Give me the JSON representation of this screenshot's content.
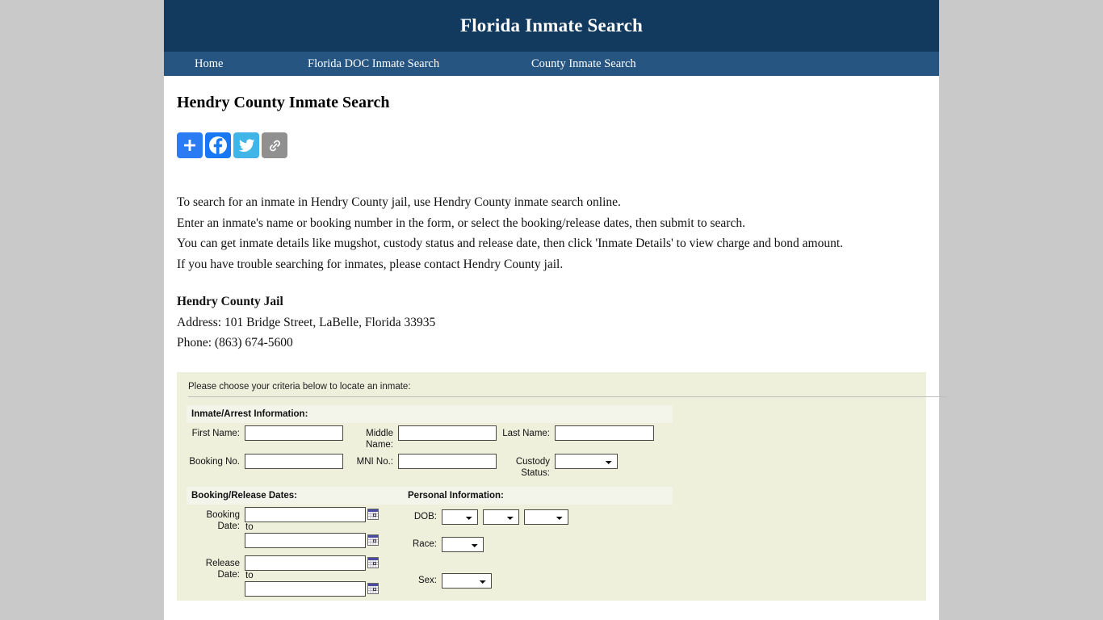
{
  "site": {
    "title": "Florida Inmate Search"
  },
  "nav": {
    "items": [
      {
        "label": "Home",
        "name": "nav-item-home"
      },
      {
        "label": "Florida DOC Inmate Search",
        "name": "nav-item-florida-doc-inmate-search"
      },
      {
        "label": "County Inmate Search",
        "name": "nav-item-county-inmate-search"
      }
    ]
  },
  "page": {
    "title": "Hendry County Inmate Search"
  },
  "share": {
    "buttons": [
      {
        "label": "Share",
        "icon": "plus-icon",
        "color": "#2b7bf3"
      },
      {
        "label": "Facebook",
        "icon": "facebook-icon",
        "color": "#1877f2"
      },
      {
        "label": "Twitter",
        "icon": "twitter-icon",
        "color": "#41b4e8"
      },
      {
        "label": "Copy Link",
        "icon": "link-icon",
        "color": "#909090"
      }
    ]
  },
  "intro": {
    "line1": "To search for an inmate in Hendry County jail, use Hendry County inmate search online.",
    "line2": "Enter an inmate's name or booking number in the form, or select the booking/release dates, then submit to search.",
    "line3": "You can get inmate details like mugshot, custody status and release date, then click 'Inmate Details' to view charge and bond amount.",
    "line4": "If you have trouble searching for inmates, please contact Hendry County jail."
  },
  "jail": {
    "name": "Hendry County Jail",
    "address": "Address: 101 Bridge Street, LaBelle, Florida 33935",
    "phone": "Phone: (863) 674-5600"
  },
  "form": {
    "criteria_text": "Please choose your criteria below to locate an inmate:",
    "section_inmate": "Inmate/Arrest Information:",
    "section_dates": "Booking/Release Dates:",
    "section_personal": "Personal Information:",
    "labels": {
      "first_name": "First Name:",
      "middle_name": "Middle Name:",
      "last_name": "Last Name:",
      "booking_no": "Booking No.",
      "mni_no": "MNI No.:",
      "custody_status": "Custody Status:",
      "booking_date": "Booking Date:",
      "release_date": "Release Date:",
      "to": "to",
      "dob": "DOB:",
      "race": "Race:",
      "sex": "Sex:"
    },
    "values": {
      "first_name": "",
      "middle_name": "",
      "last_name": "",
      "booking_no": "",
      "mni_no": "",
      "custody_status": "",
      "booking_date_from": "",
      "booking_date_to": "",
      "release_date_from": "",
      "release_date_to": "",
      "dob_month": "",
      "dob_day": "",
      "dob_year": "",
      "race": "",
      "sex": ""
    }
  },
  "colors": {
    "header_bg": "#123a5e",
    "nav_bg": "#255580",
    "form_bg": "#eef0dc",
    "section_band_bg": "#f3f4ea",
    "page_bg": "#c9c9c9"
  }
}
